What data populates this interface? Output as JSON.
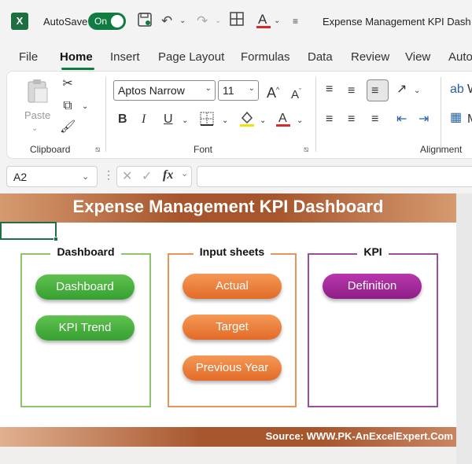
{
  "titlebar": {
    "app_icon": "X",
    "autosave_label": "AutoSave",
    "autosave_state": "On",
    "document_title": "Expense Management KPI Dash",
    "icons": [
      "excel-logo-icon",
      "save-icon",
      "undo-icon",
      "redo-icon",
      "table-icon",
      "font-color-icon",
      "customize-dropdown-icon"
    ]
  },
  "ribbon_tabs": [
    "File",
    "Home",
    "Insert",
    "Page Layout",
    "Formulas",
    "Data",
    "Review",
    "View",
    "Auto"
  ],
  "active_tab": "Home",
  "ribbon": {
    "clipboard": {
      "label": "Clipboard",
      "paste_label": "Paste"
    },
    "font": {
      "label": "Font",
      "font_name": "Aptos Narrow",
      "font_size": "11",
      "bold": "B",
      "italic": "I",
      "underline": "U",
      "grow": "A",
      "shrink": "A"
    },
    "alignment": {
      "label": "Alignment"
    }
  },
  "formula_bar": {
    "cell_ref": "A2",
    "fx_label": "fx",
    "value": ""
  },
  "dashboard": {
    "title": "Expense Management KPI Dashboard",
    "groups": [
      {
        "title": "Dashboard",
        "color": "#8cc56a",
        "buttons": [
          "Dashboard",
          "KPI Trend"
        ]
      },
      {
        "title": "Input sheets",
        "color": "#e8935a",
        "buttons": [
          "Actual",
          "Target",
          "Previous Year"
        ]
      },
      {
        "title": "KPI",
        "color": "#9b4f9a",
        "buttons": [
          "Definition"
        ]
      }
    ],
    "footer": "Source: WWW.PK-AnExcelExpert.Com"
  },
  "colors": {
    "banner": "#a6552c",
    "green_button": "#44ad3a",
    "orange_button": "#e9772f",
    "purple_button": "#a02a96",
    "excel_green": "#107c41"
  }
}
